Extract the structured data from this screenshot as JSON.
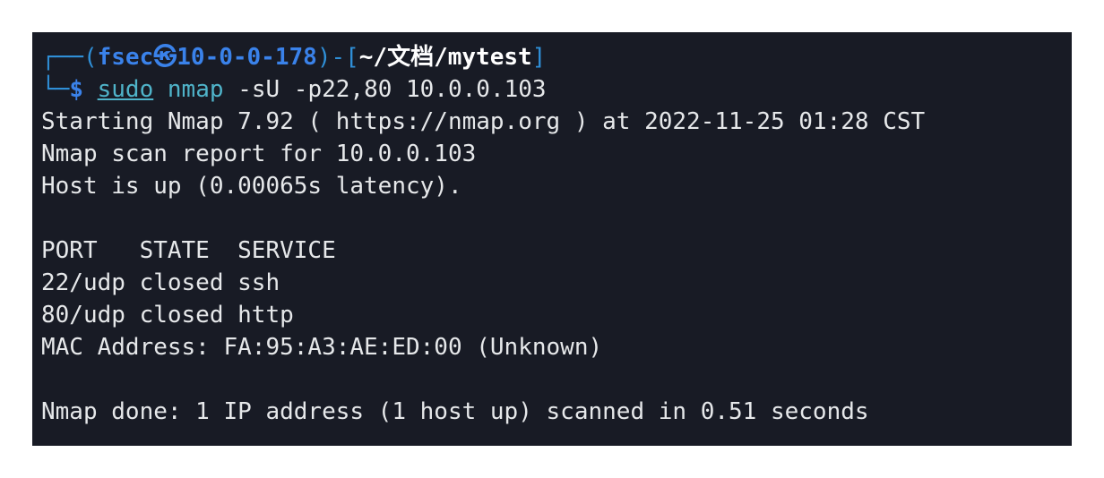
{
  "terminal": {
    "prompt": {
      "top_prefix": "┌──(",
      "user": "fsec",
      "at_symbol": "㉿",
      "host": "10-0-0-178",
      "mid": ")-[",
      "path": "~/文档/mytest",
      "close": "]",
      "bottom_prefix": "└─",
      "dollar": "$",
      "sudo": "sudo",
      "command": "nmap",
      "args": "-sU -p22,80 10.0.0.103"
    },
    "output": {
      "line1": "Starting Nmap 7.92 ( https://nmap.org ) at 2022-11-25 01:28 CST",
      "line2": "Nmap scan report for 10.0.0.103",
      "line3": "Host is up (0.00065s latency).",
      "table_header": "PORT   STATE  SERVICE",
      "row1": "22/udp closed ssh",
      "row2": "80/udp closed http",
      "mac": "MAC Address: FA:95:A3:AE:ED:00 (Unknown)",
      "done": "Nmap done: 1 IP address (1 host up) scanned in 0.51 seconds"
    }
  }
}
